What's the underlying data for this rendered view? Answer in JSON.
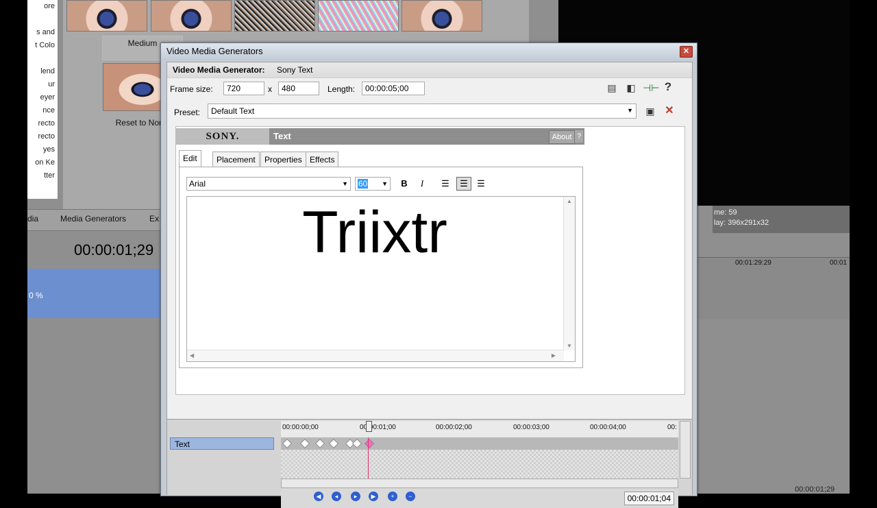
{
  "background": {
    "left_list": [
      "ore",
      "",
      "s and",
      "t Colo",
      "",
      "lend",
      "ur",
      "eyer",
      "nce",
      "recto",
      "recto",
      "yes",
      "on Ke",
      "tter"
    ],
    "thumbs": {
      "medium_label": "Medium",
      "reset_label": "Reset to None"
    },
    "tabs": {
      "media": "dia",
      "media_generators": "Media Generators",
      "ex": "Ex"
    },
    "timecode": "00:00:01;29",
    "zoom": "0 %",
    "right_info": {
      "frame_line": "me:  59",
      "size_line": "lay:  396x291x32"
    },
    "right_ruler": {
      "t1": "00:01:29:29",
      "t2": "00:01"
    },
    "bottom_right_time": "00:00:01;29"
  },
  "dialog": {
    "title": "Video Media Generators",
    "generator_label": "Video Media Generator:",
    "generator_name": "Sony Text",
    "frame_size_label": "Frame size:",
    "frame_width": "720",
    "x_label": "x",
    "frame_height": "480",
    "length_label": "Length:",
    "length_value": "00:00:05;00",
    "preset_label": "Preset:",
    "preset_value": "Default Text",
    "plugin": {
      "brand": "SONY.",
      "name": "Text",
      "about": "About",
      "help": "?"
    },
    "tabs": [
      "Edit",
      "Placement",
      "Properties",
      "Effects"
    ],
    "font_name": "Arial",
    "font_size": "60",
    "bold": "B",
    "italic": "I",
    "text_content": "Triixtr",
    "keyframes": {
      "track_label": "Text",
      "ruler": [
        "00:00:00;00",
        "00:00:01;00",
        "00:00:02;00",
        "00:00:03;00",
        "00:00:04;00",
        "00:"
      ],
      "current_time": "00:00:01;04"
    }
  },
  "colors": {
    "track_blue": "#9db6de",
    "title_bar": "#dfe6ee",
    "close_red": "#c84a3a"
  }
}
